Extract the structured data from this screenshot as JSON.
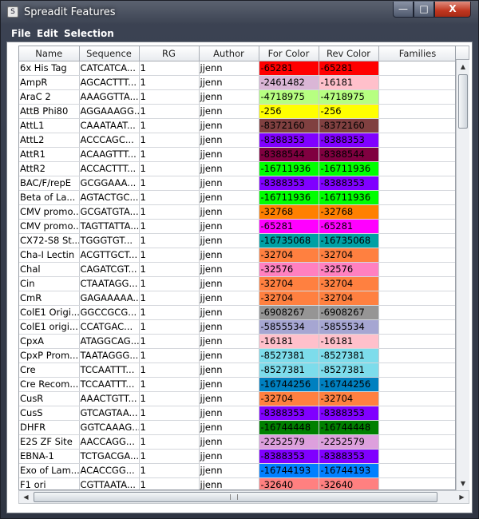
{
  "window": {
    "title": "Spreadit Features",
    "app_icon_glyph": "S",
    "minimize_glyph": "—",
    "maximize_glyph": "□",
    "close_glyph": "X"
  },
  "menu": [
    "File",
    "Edit",
    "Selection"
  ],
  "table": {
    "columns": [
      "Name",
      "Sequence",
      "RG",
      "Author",
      "For Color",
      "Rev Color",
      "Families"
    ],
    "rows": [
      {
        "name": "6x His Tag",
        "sequence": "CATCATCA...",
        "rg": "1",
        "author": "jjenn",
        "for_color": "-65281",
        "for_hex": "#ff0000",
        "rev_color": "-65281",
        "rev_hex": "#ff0000",
        "families": ""
      },
      {
        "name": "AmpR",
        "sequence": "AGCACTTT...",
        "rg": "1",
        "author": "jjenn",
        "for_color": "-2461482",
        "for_hex": "#dab6d6",
        "rev_color": "-16181",
        "rev_hex": "#ffc0cb",
        "families": ""
      },
      {
        "name": "AraC 2",
        "sequence": "AAAGGTTA...",
        "rg": "1",
        "author": "jjenn",
        "for_color": "-4718975",
        "for_hex": "#b7ff81",
        "rev_color": "-4718975",
        "rev_hex": "#b7ff81",
        "families": ""
      },
      {
        "name": "AttB Phi80",
        "sequence": "AGGAAAGG...",
        "rg": "1",
        "author": "jjenn",
        "for_color": "-256",
        "for_hex": "#ffff00",
        "rev_color": "-256",
        "rev_hex": "#ffff00",
        "families": ""
      },
      {
        "name": "AttL1",
        "sequence": "CAAATAAT...",
        "rg": "1",
        "author": "jjenn",
        "for_color": "-8372160",
        "for_hex": "#804040",
        "rev_color": "-8372160",
        "rev_hex": "#804040",
        "families": ""
      },
      {
        "name": "AttL2",
        "sequence": "ACCCAGC...",
        "rg": "1",
        "author": "jjenn",
        "for_color": "-8388353",
        "for_hex": "#8000ff",
        "rev_color": "-8388353",
        "rev_hex": "#8000ff",
        "families": ""
      },
      {
        "name": "AttR1",
        "sequence": "ACAAGTTT...",
        "rg": "1",
        "author": "jjenn",
        "for_color": "-8388544",
        "for_hex": "#800040",
        "rev_color": "-8388544",
        "rev_hex": "#800040",
        "families": ""
      },
      {
        "name": "AttR2",
        "sequence": "ACCACTTT...",
        "rg": "1",
        "author": "jjenn",
        "for_color": "-16711936",
        "for_hex": "#00ff00",
        "rev_color": "-16711936",
        "rev_hex": "#00ff00",
        "families": ""
      },
      {
        "name": "BAC/F/repE",
        "sequence": "GCGGAAA...",
        "rg": "1",
        "author": "jjenn",
        "for_color": "-8388353",
        "for_hex": "#8000ff",
        "rev_color": "-8388353",
        "rev_hex": "#8000ff",
        "families": ""
      },
      {
        "name": "Beta of La...",
        "sequence": "AGTACTGC...",
        "rg": "1",
        "author": "jjenn",
        "for_color": "-16711936",
        "for_hex": "#00ff00",
        "rev_color": "-16711936",
        "rev_hex": "#00ff00",
        "families": ""
      },
      {
        "name": "CMV promo...",
        "sequence": "GCGATGTA...",
        "rg": "1",
        "author": "jjenn",
        "for_color": "-32768",
        "for_hex": "#ff8000",
        "rev_color": "-32768",
        "rev_hex": "#ff8000",
        "families": ""
      },
      {
        "name": "CMV promo...",
        "sequence": "TAGTTATTA...",
        "rg": "1",
        "author": "jjenn",
        "for_color": "-65281",
        "for_hex": "#ff00ff",
        "rev_color": "-65281",
        "rev_hex": "#ff00ff",
        "families": ""
      },
      {
        "name": "CX72-S8 St...",
        "sequence": "TGGGTGT...",
        "rg": "1",
        "author": "jjenn",
        "for_color": "-16735068",
        "for_hex": "#00a0a4",
        "rev_color": "-16735068",
        "rev_hex": "#00a0a4",
        "families": ""
      },
      {
        "name": "Cha-I Lectin",
        "sequence": "ACGTTGCT...",
        "rg": "1",
        "author": "jjenn",
        "for_color": "-32704",
        "for_hex": "#ff8040",
        "rev_color": "-32704",
        "rev_hex": "#ff8040",
        "families": ""
      },
      {
        "name": "Chal",
        "sequence": "CAGATCGT...",
        "rg": "1",
        "author": "jjenn",
        "for_color": "-32576",
        "for_hex": "#ff80c0",
        "rev_color": "-32576",
        "rev_hex": "#ff80c0",
        "families": ""
      },
      {
        "name": "Cin",
        "sequence": "CTAATAGG...",
        "rg": "1",
        "author": "jjenn",
        "for_color": "-32704",
        "for_hex": "#ff8040",
        "rev_color": "-32704",
        "rev_hex": "#ff8040",
        "families": ""
      },
      {
        "name": "CmR",
        "sequence": "GAGAAAAA...",
        "rg": "1",
        "author": "jjenn",
        "for_color": "-32704",
        "for_hex": "#ff8040",
        "rev_color": "-32704",
        "rev_hex": "#ff8040",
        "families": ""
      },
      {
        "name": "ColE1 Origi...",
        "sequence": "GGCCGCG...",
        "rg": "1",
        "author": "jjenn",
        "for_color": "-6908267",
        "for_hex": "#969595",
        "rev_color": "-6908267",
        "rev_hex": "#969595",
        "families": ""
      },
      {
        "name": "ColE1 origi...",
        "sequence": "CCATGAC...",
        "rg": "1",
        "author": "jjenn",
        "for_color": "-5855534",
        "for_hex": "#a6a6d2",
        "rev_color": "-5855534",
        "rev_hex": "#a6a6d2",
        "families": ""
      },
      {
        "name": "CpxA",
        "sequence": "ATAGGCAG...",
        "rg": "1",
        "author": "jjenn",
        "for_color": "-16181",
        "for_hex": "#ffc0cb",
        "rev_color": "-16181",
        "rev_hex": "#ffc0cb",
        "families": ""
      },
      {
        "name": "CpxP Prom...",
        "sequence": "TAATAGGG...",
        "rg": "1",
        "author": "jjenn",
        "for_color": "-8527381",
        "for_hex": "#7ddceb",
        "rev_color": "-8527381",
        "rev_hex": "#7ddceb",
        "families": ""
      },
      {
        "name": "Cre",
        "sequence": "TCCAATTT...",
        "rg": "1",
        "author": "jjenn",
        "for_color": "-8527381",
        "for_hex": "#7ddceb",
        "rev_color": "-8527381",
        "rev_hex": "#7ddceb",
        "families": ""
      },
      {
        "name": "Cre Recom...",
        "sequence": "TCCAATTT...",
        "rg": "1",
        "author": "jjenn",
        "for_color": "-16744256",
        "for_hex": "#0080c0",
        "rev_color": "-16744256",
        "rev_hex": "#0080c0",
        "families": ""
      },
      {
        "name": "CusR",
        "sequence": "AAACTGTT...",
        "rg": "1",
        "author": "jjenn",
        "for_color": "-32704",
        "for_hex": "#ff8040",
        "rev_color": "-32704",
        "rev_hex": "#ff8040",
        "families": ""
      },
      {
        "name": "CusS",
        "sequence": "GTCAGTAA...",
        "rg": "1",
        "author": "jjenn",
        "for_color": "-8388353",
        "for_hex": "#8000ff",
        "rev_color": "-8388353",
        "rev_hex": "#8000ff",
        "families": ""
      },
      {
        "name": "DHFR",
        "sequence": "GGTCAAAG...",
        "rg": "1",
        "author": "jjenn",
        "for_color": "-16744448",
        "for_hex": "#008000",
        "rev_color": "-16744448",
        "rev_hex": "#008000",
        "families": ""
      },
      {
        "name": "E2S ZF Site",
        "sequence": "AACCAGG...",
        "rg": "1",
        "author": "jjenn",
        "for_color": "-2252579",
        "for_hex": "#dda0dd",
        "rev_color": "-2252579",
        "rev_hex": "#dda0dd",
        "families": ""
      },
      {
        "name": "EBNA-1",
        "sequence": "TCTGACGA...",
        "rg": "1",
        "author": "jjenn",
        "for_color": "-8388353",
        "for_hex": "#8000ff",
        "rev_color": "-8388353",
        "rev_hex": "#8000ff",
        "families": ""
      },
      {
        "name": "Exo of Lam...",
        "sequence": "ACACCGG...",
        "rg": "1",
        "author": "jjenn",
        "for_color": "-16744193",
        "for_hex": "#0080ff",
        "rev_color": "-16744193",
        "rev_hex": "#0080ff",
        "families": ""
      },
      {
        "name": "F1 ori",
        "sequence": "CGTTAATA...",
        "rg": "1",
        "author": "jjenn",
        "for_color": "-32640",
        "for_hex": "#ff8080",
        "rev_color": "-32640",
        "rev_hex": "#ff8080",
        "families": ""
      }
    ]
  },
  "scroll": {
    "up_glyph": "▲",
    "down_glyph": "▼",
    "left_glyph": "◀",
    "right_glyph": "▶"
  }
}
